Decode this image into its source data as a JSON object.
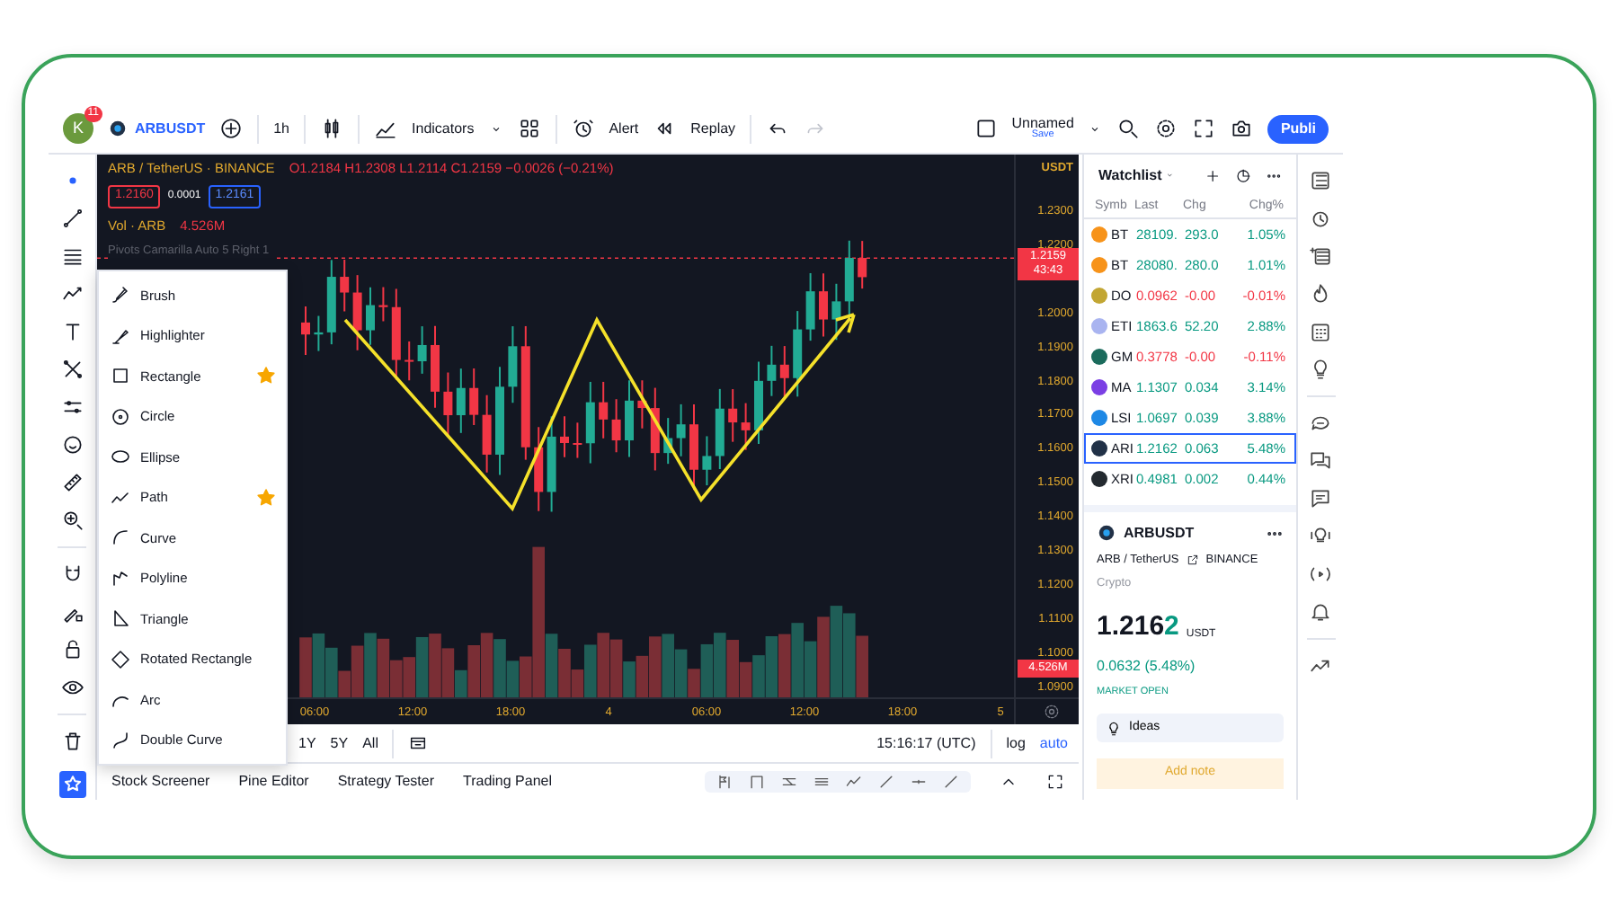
{
  "top_toolbar": {
    "avatar": "K",
    "notifications": "11",
    "symbol": "ARBUSDT",
    "interval": "1h",
    "indicators": "Indicators",
    "alert": "Alert",
    "replay": "Replay",
    "layout_name": "Unnamed",
    "save": "Save",
    "publish": "Publi"
  },
  "chart": {
    "title": "ARB / TetherUS · BINANCE",
    "ohlc": "O1.2184 H1.2308 L1.2114 C1.2159 −0.0026 (−0.21%)",
    "bid": "1.2160",
    "spread": "0.0001",
    "ask": "1.2161",
    "volume_label": "Vol · ARB",
    "volume_value": "4.526M",
    "pivots": "Pivots Camarilla Auto 5 Right 1",
    "currency": "USDT",
    "price_ticks": [
      "1.2300",
      "1.2200",
      "1.2000",
      "1.1900",
      "1.1800",
      "1.1700",
      "1.1600",
      "1.1500",
      "1.1400",
      "1.1300",
      "1.1200",
      "1.1100",
      "1.1000",
      "1.0900"
    ],
    "last_price": "1.2159",
    "countdown": "43:43",
    "volume_tag": "4.526M",
    "time_ticks": [
      "06:00",
      "12:00",
      "18:00",
      "4",
      "06:00",
      "12:00",
      "18:00",
      "5"
    ]
  },
  "drawing_menu": [
    {
      "label": "Brush",
      "starred": false
    },
    {
      "label": "Highlighter",
      "starred": false
    },
    {
      "label": "Rectangle",
      "starred": true
    },
    {
      "label": "Circle",
      "starred": false
    },
    {
      "label": "Ellipse",
      "starred": false
    },
    {
      "label": "Path",
      "starred": true
    },
    {
      "label": "Curve",
      "starred": false
    },
    {
      "label": "Polyline",
      "starred": false
    },
    {
      "label": "Triangle",
      "starred": false
    },
    {
      "label": "Rotated Rectangle",
      "starred": false
    },
    {
      "label": "Arc",
      "starred": false
    },
    {
      "label": "Double Curve",
      "starred": false
    }
  ],
  "bottom_bar": {
    "ranges": [
      "1Y",
      "5Y",
      "All"
    ],
    "clock": "15:16:17 (UTC)",
    "scale_modes": [
      {
        "label": "log",
        "selected": false
      },
      {
        "label": "auto",
        "selected": true
      }
    ]
  },
  "bottom_tabs": [
    "Stock Screener",
    "Pine Editor",
    "Strategy Tester",
    "Trading Panel"
  ],
  "watchlist": {
    "title": "Watchlist",
    "columns": [
      "Symb",
      "Last",
      "Chg",
      "Chg%"
    ],
    "rows": [
      {
        "symbol": "BT",
        "last": "28109.",
        "chg": "293.0",
        "chg_pct": "1.05%",
        "up": true,
        "color": "#f7931a",
        "selected": false
      },
      {
        "symbol": "BT",
        "last": "28080.",
        "chg": "280.0",
        "chg_pct": "1.01%",
        "up": true,
        "color": "#f7931a",
        "selected": false
      },
      {
        "symbol": "DO",
        "last": "0.0962",
        "chg": "-0.00",
        "chg_pct": "-0.01%",
        "up": false,
        "color": "#c2a633",
        "selected": false
      },
      {
        "symbol": "ETI",
        "last": "1863.6",
        "chg": "52.20",
        "chg_pct": "2.88%",
        "up": true,
        "color": "#a9b4f0",
        "selected": false
      },
      {
        "symbol": "GM",
        "last": "0.3778",
        "chg": "-0.00",
        "chg_pct": "-0.11%",
        "up": false,
        "color": "#1b6b5c",
        "selected": false
      },
      {
        "symbol": "MA",
        "last": "1.1307",
        "chg": "0.034",
        "chg_pct": "3.14%",
        "up": true,
        "color": "#7b3fe4",
        "selected": false
      },
      {
        "symbol": "LSI",
        "last": "1.0697",
        "chg": "0.039",
        "chg_pct": "3.88%",
        "up": true,
        "color": "#1e88e5",
        "selected": false
      },
      {
        "symbol": "ARI",
        "last": "1.2162",
        "chg": "0.063",
        "chg_pct": "5.48%",
        "up": true,
        "color": "#213147",
        "selected": true
      },
      {
        "symbol": "XRI",
        "last": "0.4981",
        "chg": "0.002",
        "chg_pct": "0.44%",
        "up": true,
        "color": "#23292f",
        "selected": false
      }
    ]
  },
  "details": {
    "symbol": "ARBUSDT",
    "pair": "ARB / TetherUS",
    "exchange": "BINANCE",
    "type": "Crypto",
    "price": "1.216",
    "price_last_digit": "2",
    "currency": "USDT",
    "change": "0.0632 (5.48%)",
    "status": "MARKET OPEN",
    "ideas": "Ideas",
    "add_note": "Add note"
  }
}
